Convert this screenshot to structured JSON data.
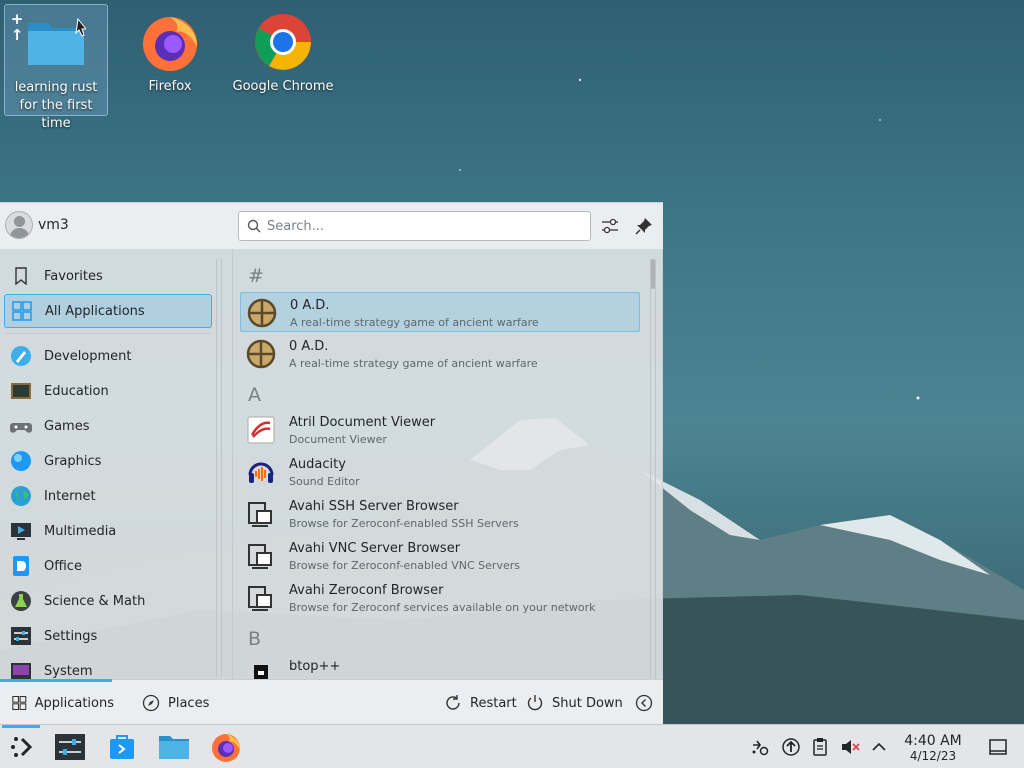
{
  "desktop": {
    "icons": [
      {
        "label": "learning rust for the first time",
        "type": "folder"
      },
      {
        "label": "Firefox",
        "type": "firefox"
      },
      {
        "label": "Google Chrome",
        "type": "chrome"
      }
    ]
  },
  "menu": {
    "user": {
      "name": "vm3"
    },
    "search": {
      "placeholder": "Search..."
    },
    "sidebar": {
      "items": [
        {
          "label": "Favorites",
          "icon": "bookmark-icon"
        },
        {
          "label": "All Applications",
          "icon": "grid-icon",
          "active": true
        },
        {
          "label": "Development",
          "icon": "development-icon"
        },
        {
          "label": "Education",
          "icon": "education-icon"
        },
        {
          "label": "Games",
          "icon": "gamepad-icon"
        },
        {
          "label": "Graphics",
          "icon": "graphics-icon"
        },
        {
          "label": "Internet",
          "icon": "globe-icon"
        },
        {
          "label": "Multimedia",
          "icon": "multimedia-icon"
        },
        {
          "label": "Office",
          "icon": "office-icon"
        },
        {
          "label": "Science & Math",
          "icon": "science-icon"
        },
        {
          "label": "Settings",
          "icon": "settings-icon"
        },
        {
          "label": "System",
          "icon": "system-icon"
        }
      ]
    },
    "apps": {
      "sections": [
        {
          "letter": "#",
          "items": [
            {
              "name": "0 A.D.",
              "desc": "A real-time strategy game of ancient warfare",
              "icon": "0ad-icon",
              "active": true
            },
            {
              "name": "0 A.D.",
              "desc": "A real-time strategy game of ancient warfare",
              "icon": "0ad-icon"
            }
          ]
        },
        {
          "letter": "A",
          "items": [
            {
              "name": "Atril Document Viewer",
              "desc": "Document Viewer",
              "icon": "atril-icon"
            },
            {
              "name": "Audacity",
              "desc": "Sound Editor",
              "icon": "audacity-icon"
            },
            {
              "name": "Avahi SSH Server Browser",
              "desc": "Browse for Zeroconf-enabled SSH Servers",
              "icon": "avahi-icon"
            },
            {
              "name": "Avahi VNC Server Browser",
              "desc": "Browse for Zeroconf-enabled VNC Servers",
              "icon": "avahi-icon"
            },
            {
              "name": "Avahi Zeroconf Browser",
              "desc": "Browse for Zeroconf services available on your network",
              "icon": "avahi-icon"
            }
          ]
        },
        {
          "letter": "B",
          "items": [
            {
              "name": "btop++",
              "desc": "",
              "icon": "btop-icon"
            }
          ]
        }
      ]
    },
    "footer": {
      "applications_label": "Applications",
      "places_label": "Places",
      "restart_label": "Restart",
      "shutdown_label": "Shut Down"
    }
  },
  "taskbar": {
    "clock": {
      "time": "4:40 AM",
      "date": "4/12/23"
    }
  },
  "colors": {
    "accent": "#3daee9",
    "panel": "#e3e5e7"
  }
}
